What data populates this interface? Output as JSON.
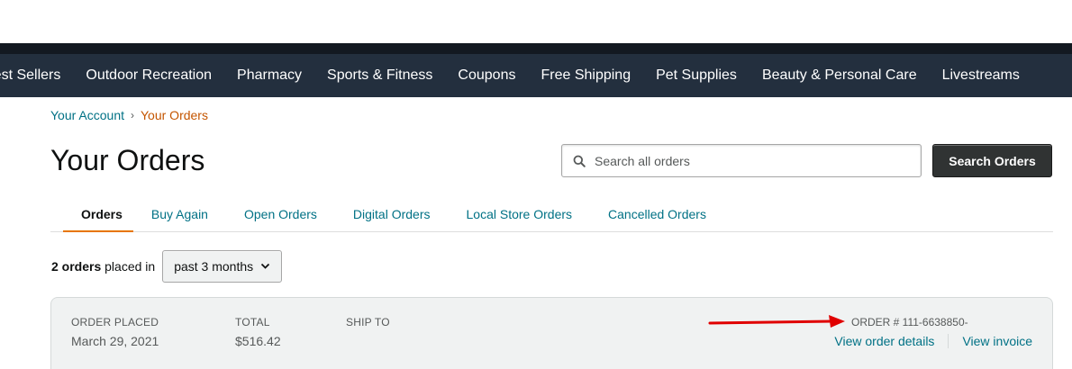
{
  "colors": {
    "nav_bg": "#232f3e",
    "nav_top": "#131921",
    "link": "#007185",
    "accent_orange": "#c45500",
    "tab_underline": "#e77600",
    "arrow": "#e00000"
  },
  "nav": {
    "items": [
      "Best Sellers",
      "Outdoor Recreation",
      "Pharmacy",
      "Sports & Fitness",
      "Coupons",
      "Free Shipping",
      "Pet Supplies",
      "Beauty & Personal Care",
      "Livestreams"
    ]
  },
  "breadcrumb": {
    "account": "Your Account",
    "separator": "›",
    "current": "Your Orders"
  },
  "page": {
    "title": "Your Orders"
  },
  "search": {
    "placeholder": "Search all orders",
    "button": "Search Orders",
    "icon": "search-icon"
  },
  "tabs": [
    "Orders",
    "Buy Again",
    "Open Orders",
    "Digital Orders",
    "Local Store Orders",
    "Cancelled Orders"
  ],
  "summary": {
    "count": "2 orders",
    "text": "placed in",
    "range": "past 3 months"
  },
  "order": {
    "placed_label": "Order placed",
    "placed_value": "March 29, 2021",
    "total_label": "Total",
    "total_value": "$516.42",
    "ship_label": "Ship to",
    "order_number": "ORDER # 111-6638850-",
    "details_link": "View order details",
    "invoice_link": "View invoice"
  }
}
